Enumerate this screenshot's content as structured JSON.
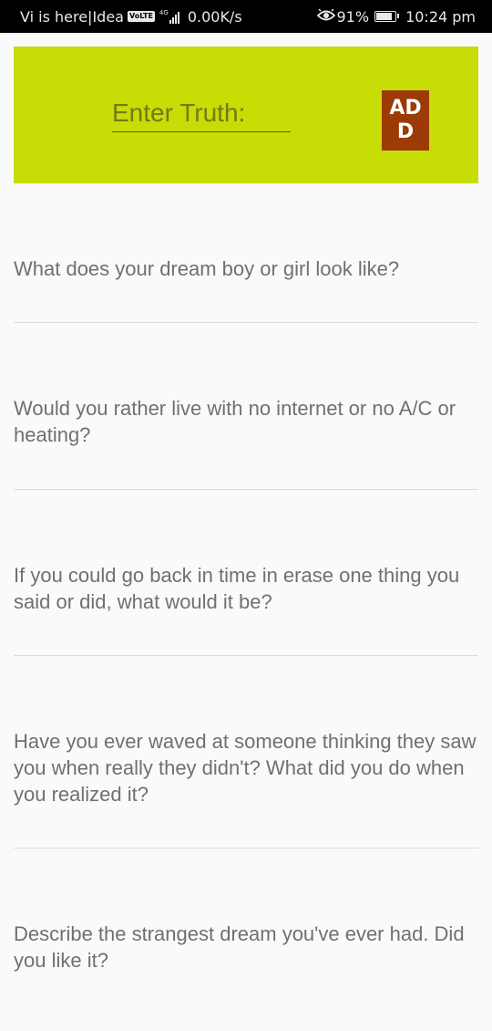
{
  "status_bar": {
    "carrier": "Vi is here|Idea",
    "volte": "VoLTE",
    "network_type": "4G",
    "speed": "0.00K/s",
    "battery": "91%",
    "battery_level": 0.91,
    "time": "10:24 pm"
  },
  "header": {
    "placeholder": "Enter Truth:",
    "add_label": "ADD",
    "accent_color": "#c8dc06",
    "button_color": "#9c3b05"
  },
  "truths": [
    "What does your dream boy or girl look like?",
    "Would you rather live with no internet or no A/C or heating?",
    "If you could go back in time in erase one thing you said or did, what would it be?",
    "Have you ever waved at someone thinking they saw you when really they didn't? What did you do when you realized it?",
    "Describe the strangest dream you've ever had. Did you like it?"
  ]
}
